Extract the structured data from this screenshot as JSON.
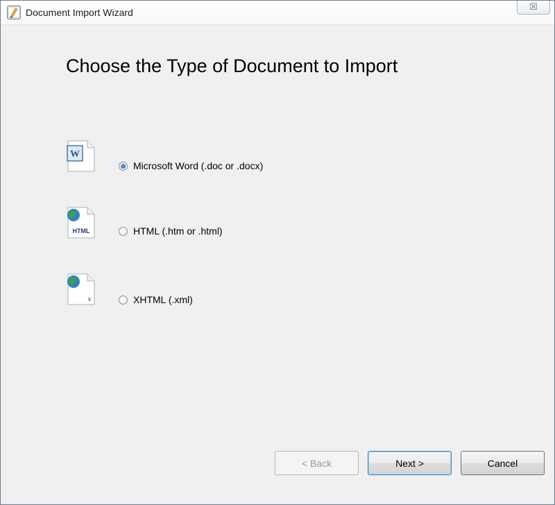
{
  "window": {
    "title": "Document Import Wizard",
    "close_glyph": "☒"
  },
  "page": {
    "title": "Choose the Type of Document to Import"
  },
  "options": [
    {
      "label": "Microsoft Word (.doc or .docx)",
      "icon": "word-document-icon",
      "selected": true
    },
    {
      "label": "HTML (.htm or .html)",
      "icon": "html-document-icon",
      "icon_text": "HTML",
      "selected": false
    },
    {
      "label": "XHTML (.xml)",
      "icon": "xhtml-document-icon",
      "icon_text": "x",
      "selected": false
    }
  ],
  "buttons": {
    "back": "< Back",
    "next": "Next >",
    "cancel": "Cancel"
  },
  "colors": {
    "dialog_background": "#f0f0f0",
    "selected_radio": "#1b4f9e",
    "default_button_border": "#3c7fb1"
  }
}
